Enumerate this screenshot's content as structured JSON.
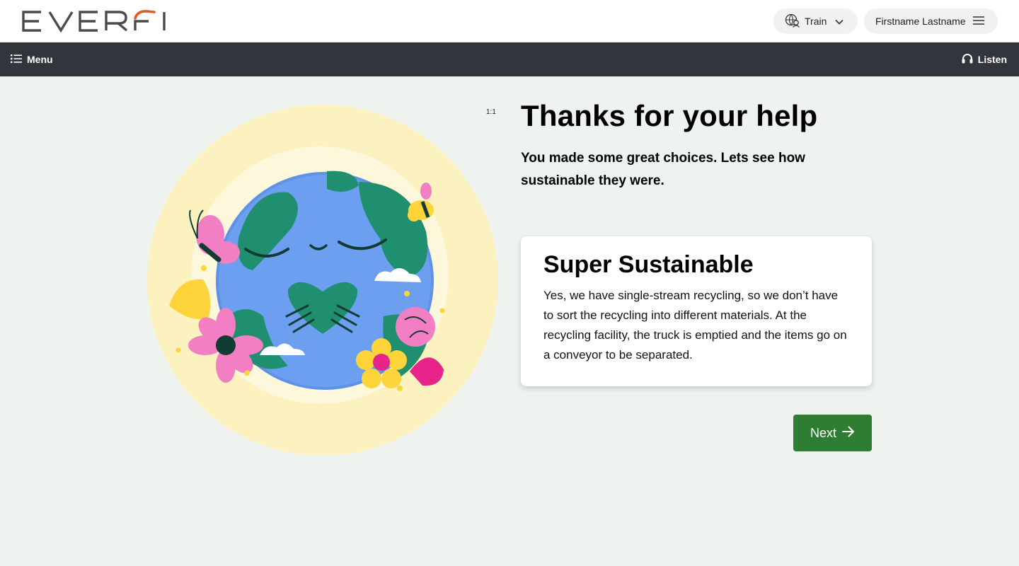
{
  "header": {
    "logo_text": "EVERFI",
    "program_selector": {
      "label": "Train",
      "icon": "globe-user-icon"
    },
    "user_menu": {
      "label": "Firstname Lastname",
      "icon": "hamburger-icon"
    }
  },
  "navbar": {
    "menu_label": "Menu",
    "listen_label": "Listen"
  },
  "illustration": {
    "ratio_label": "1:1"
  },
  "main": {
    "title": "Thanks for your help",
    "subtitle": "You made some great choices. Lets see how sustainable they were.",
    "result_card": {
      "title": "Super Sustainable",
      "body": "Yes, we have single-stream recycling, so we don’t have to sort the recycling into different materials. At the recycling facility, the truck is emptied and the items go on a conveyor to be separated."
    },
    "next_label": "Next"
  },
  "colors": {
    "navbar": "#33353d",
    "next_button": "#2f7d32",
    "background": "#eff3ef",
    "logo_accent": "#e05a2b"
  }
}
